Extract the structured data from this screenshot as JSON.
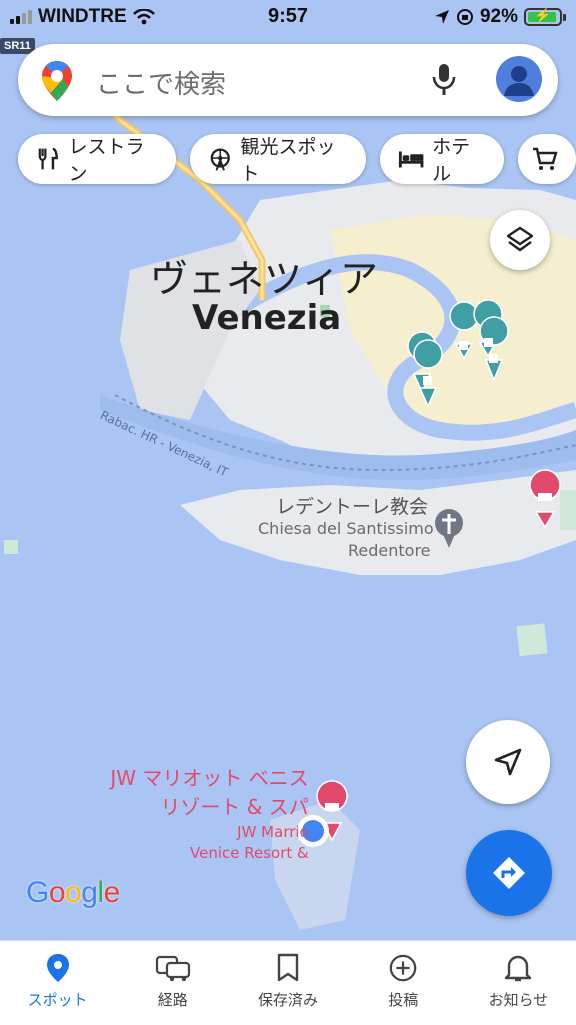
{
  "status_bar": {
    "carrier": "WINDTRE",
    "time": "9:57",
    "battery": "92%",
    "battery_level": 0.92
  },
  "road_shield": "SR11",
  "search": {
    "placeholder": "ここで検索"
  },
  "chips": [
    {
      "label": "レストラン",
      "icon": "fork-knife-icon"
    },
    {
      "label": "観光スポット",
      "icon": "ferris-wheel-icon"
    },
    {
      "label": "ホテル",
      "icon": "bed-icon"
    },
    {
      "label": "",
      "icon": "shopping-cart-icon"
    }
  ],
  "map": {
    "city_name_ja": "ヴェネツィア",
    "city_name_en": "Venezia",
    "ferry_route": "Rabac. HR - Venezia, IT",
    "church_ja": "レデントーレ教会",
    "church_en_1": "Chiesa del Santissimo",
    "church_en_2": "Redentore",
    "hotel_ja_1": "JW マリオット ベニス",
    "hotel_ja_2": "リゾート & スパ",
    "hotel_en_1": "JW Marrio",
    "hotel_en_2": "Venice Resort &",
    "water_color": "#aac5f4",
    "land_color": "#e8eaed",
    "pin_color": "#3f9fa5",
    "hotel_pin_color": "#e24a6b"
  },
  "branding": {
    "google": "Google"
  },
  "bottom_nav": [
    {
      "label": "スポット",
      "icon": "location-pin-icon",
      "active": true
    },
    {
      "label": "経路",
      "icon": "car-icon",
      "active": false
    },
    {
      "label": "保存済み",
      "icon": "bookmark-icon",
      "active": false
    },
    {
      "label": "投稿",
      "icon": "plus-circle-icon",
      "active": false
    },
    {
      "label": "お知らせ",
      "icon": "bell-icon",
      "active": false
    }
  ]
}
